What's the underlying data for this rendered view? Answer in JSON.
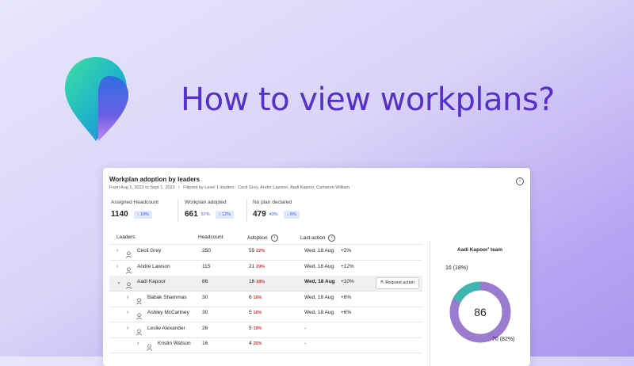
{
  "hero": {
    "title": "How to view workplans?",
    "logo_icon": "map-pin-logo"
  },
  "card": {
    "title": "Workplan adoption by leaders",
    "date_range": "From Aug 1, 2023 to Sept 1, 2023",
    "filter_text": "Filtered by Level 1 leaders : Cecil Grey, Andre Lawson, Aadi Kapoor, Cameron William",
    "stats": [
      {
        "label": "Assigned Headcount",
        "value": "1140",
        "pct": "",
        "delta": "10%",
        "direction": "up"
      },
      {
        "label": "Workplan adopted",
        "value": "661",
        "pct": "57%",
        "delta": "12%",
        "direction": "up"
      },
      {
        "label": "No plan declared",
        "value": "479",
        "pct": "43%",
        "delta": "6%",
        "direction": "down"
      }
    ],
    "columns": {
      "leaders": "Leaders",
      "headcount": "Headcount",
      "adoption": "Adoption",
      "last_action": "Last action"
    },
    "rows": [
      {
        "name": "Cecil Grey",
        "headcount": "250",
        "adoption": "55",
        "adoption_pct": "22%",
        "last_action": "Wed, 18 Aug",
        "delta": "+2%",
        "level": 0,
        "expanded": false
      },
      {
        "name": "Andre Lawson",
        "headcount": "115",
        "adoption": "21",
        "adoption_pct": "19%",
        "last_action": "Wed, 18 Aug",
        "delta": "+12%",
        "level": 0,
        "expanded": false
      },
      {
        "name": "Aadi Kapoor",
        "headcount": "86",
        "adoption": "16",
        "adoption_pct": "18%",
        "last_action": "Wed, 18 Aug",
        "delta": "+10%",
        "level": 0,
        "expanded": true,
        "action_button": "Request action"
      },
      {
        "name": "Babak Shammas",
        "headcount": "30",
        "adoption": "6",
        "adoption_pct": "16%",
        "last_action": "Wed, 18 Aug",
        "delta": "+8%",
        "level": 1,
        "expanded": false
      },
      {
        "name": "Ashley McCartney",
        "headcount": "30",
        "adoption": "5",
        "adoption_pct": "16%",
        "last_action": "Wed, 18 Aug",
        "delta": "+6%",
        "level": 1,
        "expanded": false
      },
      {
        "name": "Leslie Alexander",
        "headcount": "26",
        "adoption": "5",
        "adoption_pct": "19%",
        "last_action": "-",
        "delta": "",
        "level": 1,
        "expanded": false
      },
      {
        "name": "Kristin Watson",
        "headcount": "16",
        "adoption": "4",
        "adoption_pct": "25%",
        "last_action": "-",
        "delta": "",
        "level": 2,
        "expanded": false
      }
    ],
    "team_panel": {
      "title": "Aadi Kapoor' team",
      "center_value": "86",
      "adopted_label": "16 (18%)",
      "not_adopted_label": "70 (82%)",
      "adopted_fraction": 0.18,
      "colors": {
        "adopted": "#3fb4b0",
        "not_adopted": "#9b7bcf"
      }
    }
  },
  "colors": {
    "headline": "#5730c9",
    "accent": "#3a5ad6",
    "negative": "#d13438"
  }
}
